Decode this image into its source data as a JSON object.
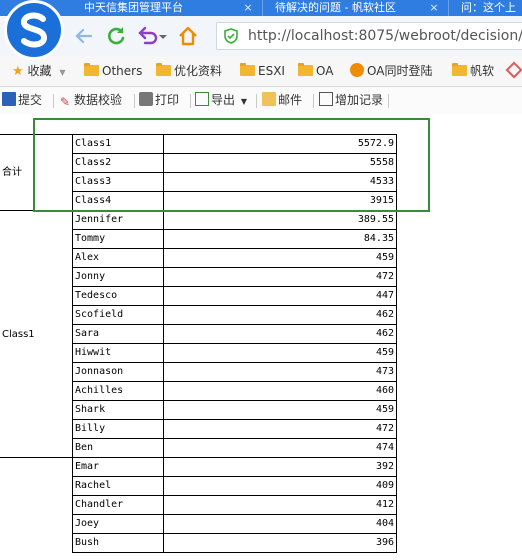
{
  "browser": {
    "tabs": [
      {
        "title": "中天信集团管理平台",
        "close": "×"
      },
      {
        "title": "待解决的问题 - 帆软社区",
        "close": "×"
      },
      {
        "title": "问：这个上",
        "close": ""
      }
    ],
    "address": "http://localhost:8075/webroot/decision/v",
    "bookmarks": [
      {
        "label": "收藏",
        "icon": "star-icon"
      },
      {
        "label": "Others",
        "icon": "folder-icon"
      },
      {
        "label": "优化资料",
        "icon": "folder-icon"
      },
      {
        "label": "ESXI",
        "icon": "folder-icon"
      },
      {
        "label": "OA",
        "icon": "folder-icon"
      },
      {
        "label": "OA同时登陆",
        "icon": "oa-icon"
      },
      {
        "label": "帆软",
        "icon": "folder-icon"
      }
    ]
  },
  "toolbar": {
    "items": [
      {
        "label": "提交",
        "icon": "save-icon"
      },
      {
        "label": "数据校验",
        "icon": "check-icon"
      },
      {
        "label": "打印",
        "icon": "print-icon"
      },
      {
        "label": "导出",
        "icon": "export-icon"
      },
      {
        "label": "邮件",
        "icon": "mail-icon"
      },
      {
        "label": "增加记录",
        "icon": "add-record-icon"
      }
    ]
  },
  "report": {
    "summary_label": "合计",
    "summary_rows": [
      {
        "name": "Class1",
        "value": "5572.9"
      },
      {
        "name": "Class2",
        "value": "5558"
      },
      {
        "name": "Class3",
        "value": "4533"
      },
      {
        "name": "Class4",
        "value": "3915"
      }
    ],
    "group1_label": "Class1",
    "group1_rows": [
      {
        "name": "Jennifer",
        "value": "389.55"
      },
      {
        "name": "Tommy",
        "value": "84.35"
      },
      {
        "name": "Alex",
        "value": "459"
      },
      {
        "name": "Jonny",
        "value": "472"
      },
      {
        "name": "Tedesco",
        "value": "447"
      },
      {
        "name": "Scofield",
        "value": "462"
      },
      {
        "name": "Sara",
        "value": "462"
      },
      {
        "name": "Hiwwit",
        "value": "459"
      },
      {
        "name": "Jonnason",
        "value": "473"
      },
      {
        "name": "Achilles",
        "value": "460"
      },
      {
        "name": "Shark",
        "value": "459"
      },
      {
        "name": "Billy",
        "value": "472"
      },
      {
        "name": "Ben",
        "value": "474"
      }
    ],
    "group2_rows": [
      {
        "name": "Emar",
        "value": "392"
      },
      {
        "name": "Rachel",
        "value": "409"
      },
      {
        "name": "Chandler",
        "value": "412"
      },
      {
        "name": "Joey",
        "value": "404"
      },
      {
        "name": "Bush",
        "value": "396"
      }
    ]
  },
  "colors": {
    "tabbar": "#2f7de1",
    "highlight": "#3b8a3b",
    "accent_green": "#3cae3c"
  }
}
